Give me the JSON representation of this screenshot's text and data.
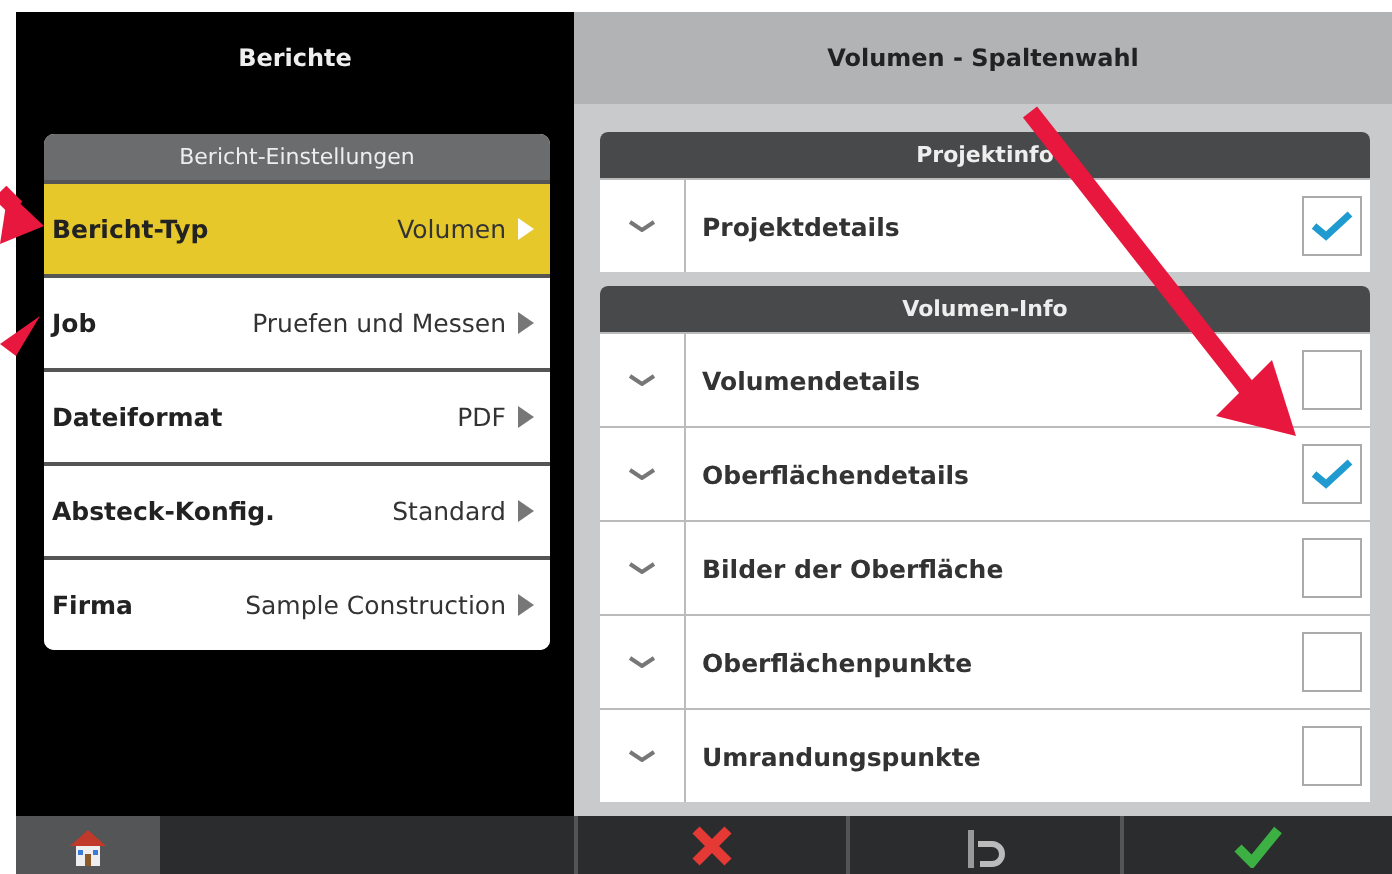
{
  "left_panel": {
    "title": "Berichte",
    "card_title": "Bericht-Einstellungen",
    "settings": [
      {
        "label": "Bericht-Typ",
        "value": "Volumen",
        "selected": true
      },
      {
        "label": "Job",
        "value": "Pruefen und Messen",
        "selected": false
      },
      {
        "label": "Dateiformat",
        "value": "PDF",
        "selected": false
      },
      {
        "label": "Absteck-Konfig.",
        "value": "Standard",
        "selected": false
      },
      {
        "label": "Firma",
        "value": "Sample Construction",
        "selected": false
      }
    ]
  },
  "right_panel": {
    "title": "Volumen - Spaltenwahl",
    "sections": [
      {
        "title": "Projektinfo",
        "items": [
          {
            "label": "Projektdetails",
            "checked": true
          }
        ]
      },
      {
        "title": "Volumen-Info",
        "items": [
          {
            "label": "Volumendetails",
            "checked": false
          },
          {
            "label": "Oberflächendetails",
            "checked": true
          },
          {
            "label": "Bilder der Oberfläche",
            "checked": false
          },
          {
            "label": "Oberflächenpunkte",
            "checked": false
          },
          {
            "label": "Umrandungspunkte",
            "checked": false
          }
        ]
      }
    ]
  }
}
